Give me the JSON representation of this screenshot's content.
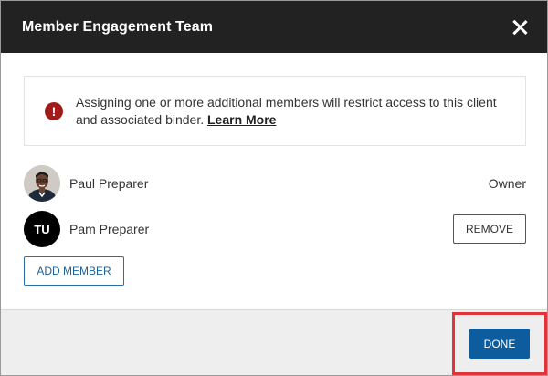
{
  "dialog": {
    "title": "Member Engagement Team",
    "close_icon": "close-icon"
  },
  "alert": {
    "icon": "exclamation-icon",
    "icon_glyph": "!",
    "icon_color": "#a31a1a",
    "message": "Assigning one or more additional members will restrict access to this client and associated binder.",
    "link_label": "Learn More"
  },
  "members": [
    {
      "name": "Paul Preparer",
      "role": "Owner",
      "avatar_type": "photo"
    },
    {
      "name": "Pam Preparer",
      "initials": "TU",
      "avatar_type": "initials",
      "action_label": "REMOVE"
    }
  ],
  "add_member_label": "ADD MEMBER",
  "footer": {
    "done_label": "DONE",
    "done_color": "#0d5c9e",
    "highlight_color": "#e0343b"
  }
}
